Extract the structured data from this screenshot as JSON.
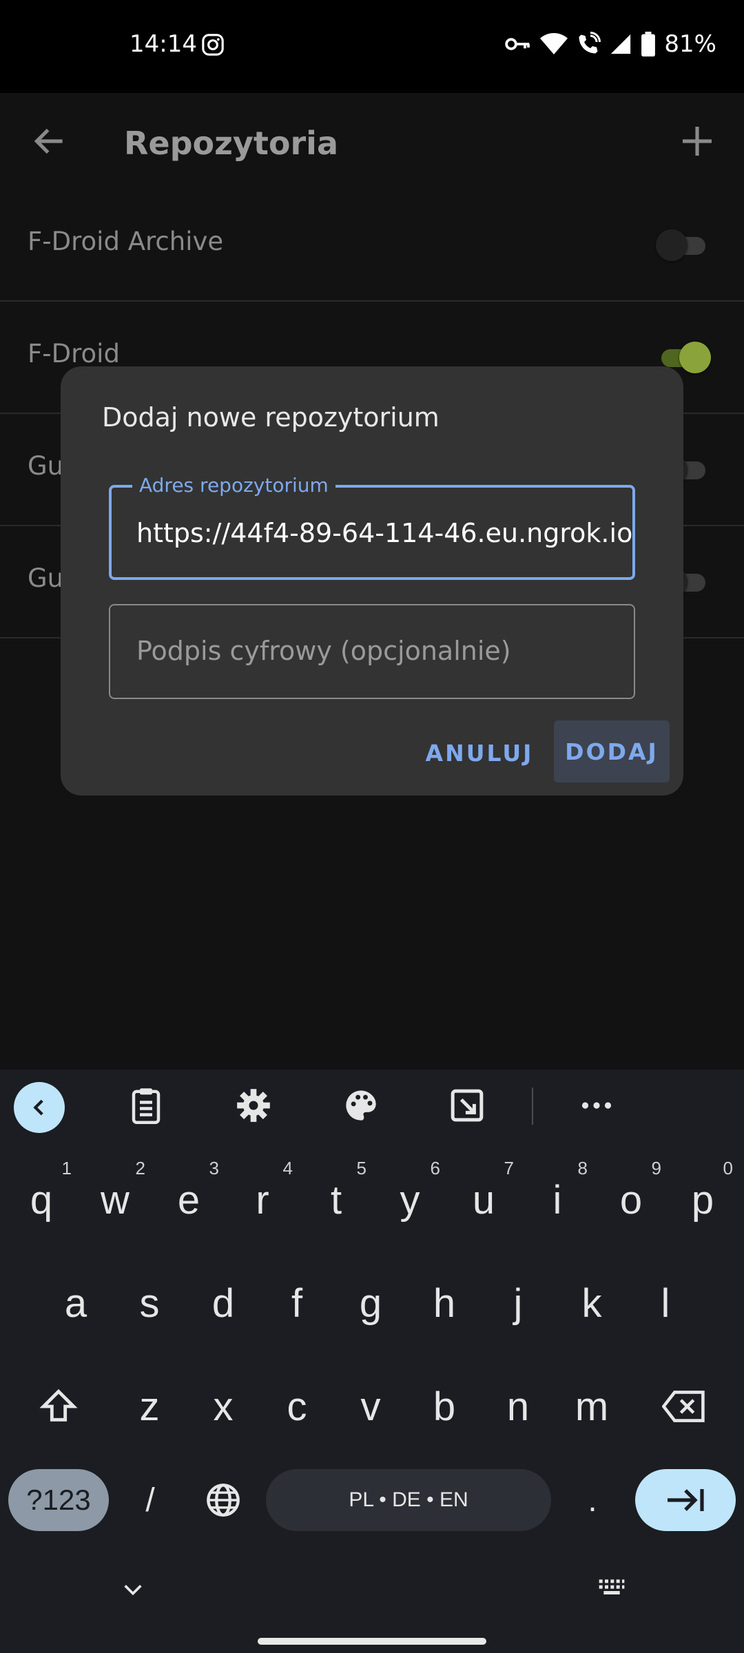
{
  "status_bar": {
    "time": "14:14",
    "battery": "81%"
  },
  "toolbar": {
    "title": "Repozytoria"
  },
  "repositories": [
    {
      "name": "F-Droid Archive",
      "enabled": false
    },
    {
      "name": "F-Droid",
      "enabled": true
    },
    {
      "name": "Gu",
      "enabled": false
    },
    {
      "name": "Gu",
      "enabled": false
    }
  ],
  "dialog": {
    "title": "Dodaj nowe repozytorium",
    "url_label": "Adres repozytorium",
    "url_value": "https://44f4-89-64-114-46.eu.ngrok.io",
    "signature_placeholder": "Podpis cyfrowy (opcjonalnie)",
    "cancel_label": "ANULUJ",
    "add_label": "DODAJ"
  },
  "keyboard": {
    "row1": [
      {
        "key": "q",
        "hint": "1"
      },
      {
        "key": "w",
        "hint": "2"
      },
      {
        "key": "e",
        "hint": "3"
      },
      {
        "key": "r",
        "hint": "4"
      },
      {
        "key": "t",
        "hint": "5"
      },
      {
        "key": "y",
        "hint": "6"
      },
      {
        "key": "u",
        "hint": "7"
      },
      {
        "key": "i",
        "hint": "8"
      },
      {
        "key": "o",
        "hint": "9"
      },
      {
        "key": "p",
        "hint": "0"
      }
    ],
    "row2": [
      "a",
      "s",
      "d",
      "f",
      "g",
      "h",
      "j",
      "k",
      "l"
    ],
    "row3": [
      "z",
      "x",
      "c",
      "v",
      "b",
      "n",
      "m"
    ],
    "num_label": "?123",
    "slash_label": "/",
    "space_label": "PL • DE • EN",
    "period_label": "."
  },
  "colors": {
    "accent": "#7ea9ec",
    "switch_on": "#8aa33a",
    "dialog_bg": "#333333",
    "keyboard_bg": "#1b1d22"
  }
}
